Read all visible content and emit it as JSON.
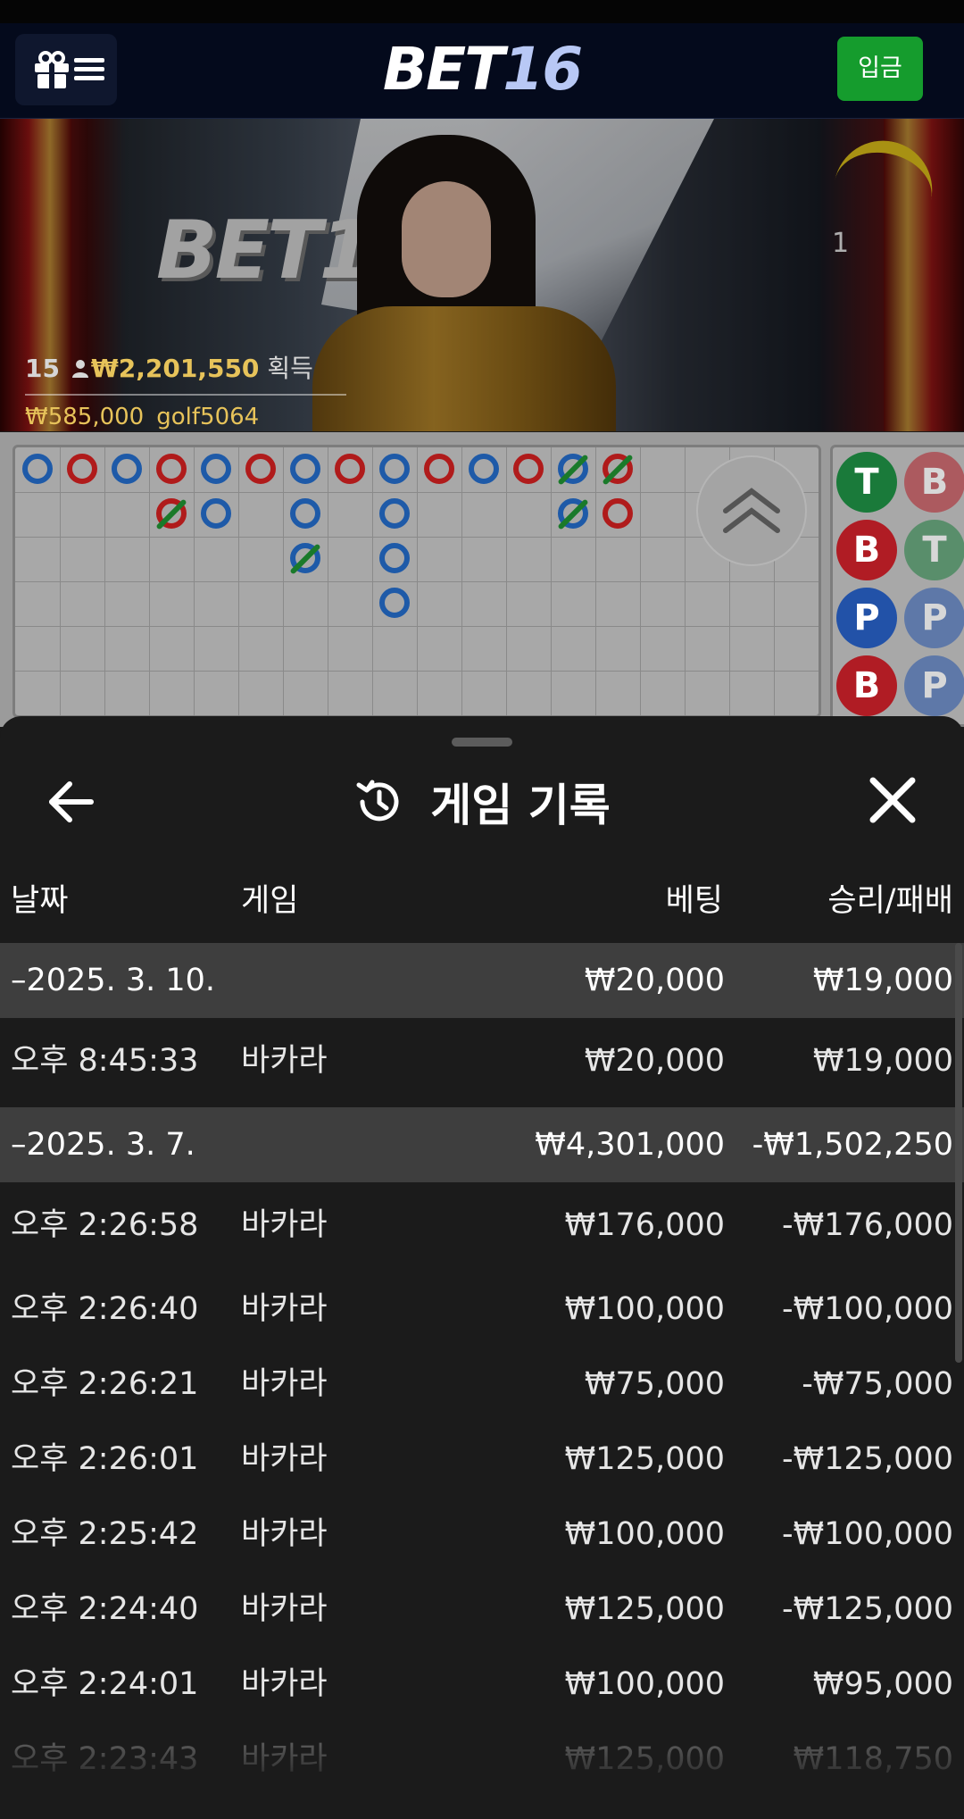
{
  "header": {
    "logo_part1": "BET",
    "logo_part2": "16",
    "deposit_label": "입금",
    "menu_icons": [
      "gift-icon",
      "hamburger-icon"
    ]
  },
  "video": {
    "background_logo": "BET16",
    "round_number": "1",
    "winners_count": "15",
    "winners_total": "₩2,201,550",
    "winners_label": "획득",
    "top_winner_amount": "₩585,000",
    "top_winner_name": "golf5064"
  },
  "roadmap": {
    "bead_plate": [
      {
        "letter": "T",
        "type": "T"
      },
      {
        "letter": "B",
        "type": "B"
      },
      {
        "letter": "B",
        "type": "B"
      },
      {
        "letter": "T",
        "type": "T"
      },
      {
        "letter": "P",
        "type": "P"
      },
      {
        "letter": "P",
        "type": "P"
      },
      {
        "letter": "B",
        "type": "B"
      },
      {
        "letter": "P",
        "type": "P"
      }
    ],
    "colors": {
      "banker": "#b01b1b",
      "player": "#1e5aa8",
      "tie": "#1a7a2a"
    }
  },
  "sheet": {
    "title": "게임 기록",
    "columns": {
      "date": "날짜",
      "game": "게임",
      "bet": "베팅",
      "winloss": "승리/패배"
    },
    "rows": [
      {
        "kind": "group",
        "date": "–2025. 3. 10.",
        "game": "",
        "bet": "₩20,000",
        "winloss": "₩19,000"
      },
      {
        "kind": "item",
        "date": "오후 8:45:33",
        "game": "바카라",
        "bet": "₩20,000",
        "winloss": "₩19,000"
      },
      {
        "kind": "group",
        "date": "–2025. 3. 7.",
        "game": "",
        "bet": "₩4,301,000",
        "winloss": "-₩1,502,250"
      },
      {
        "kind": "item",
        "date": "오후 2:26:58",
        "game": "바카라",
        "bet": "₩176,000",
        "winloss": "-₩176,000"
      },
      {
        "kind": "item",
        "date": "오후 2:26:40",
        "game": "바카라",
        "bet": "₩100,000",
        "winloss": "-₩100,000"
      },
      {
        "kind": "item",
        "date": "오후 2:26:21",
        "game": "바카라",
        "bet": "₩75,000",
        "winloss": "-₩75,000"
      },
      {
        "kind": "item",
        "date": "오후 2:26:01",
        "game": "바카라",
        "bet": "₩125,000",
        "winloss": "-₩125,000"
      },
      {
        "kind": "item",
        "date": "오후 2:25:42",
        "game": "바카라",
        "bet": "₩100,000",
        "winloss": "-₩100,000"
      },
      {
        "kind": "item",
        "date": "오후 2:24:40",
        "game": "바카라",
        "bet": "₩125,000",
        "winloss": "-₩125,000"
      },
      {
        "kind": "item",
        "date": "오후 2:24:01",
        "game": "바카라",
        "bet": "₩100,000",
        "winloss": "₩95,000"
      },
      {
        "kind": "item",
        "date": "오후 2:23:43",
        "game": "바카라",
        "bet": "₩125,000",
        "winloss": "₩118,750"
      }
    ]
  }
}
